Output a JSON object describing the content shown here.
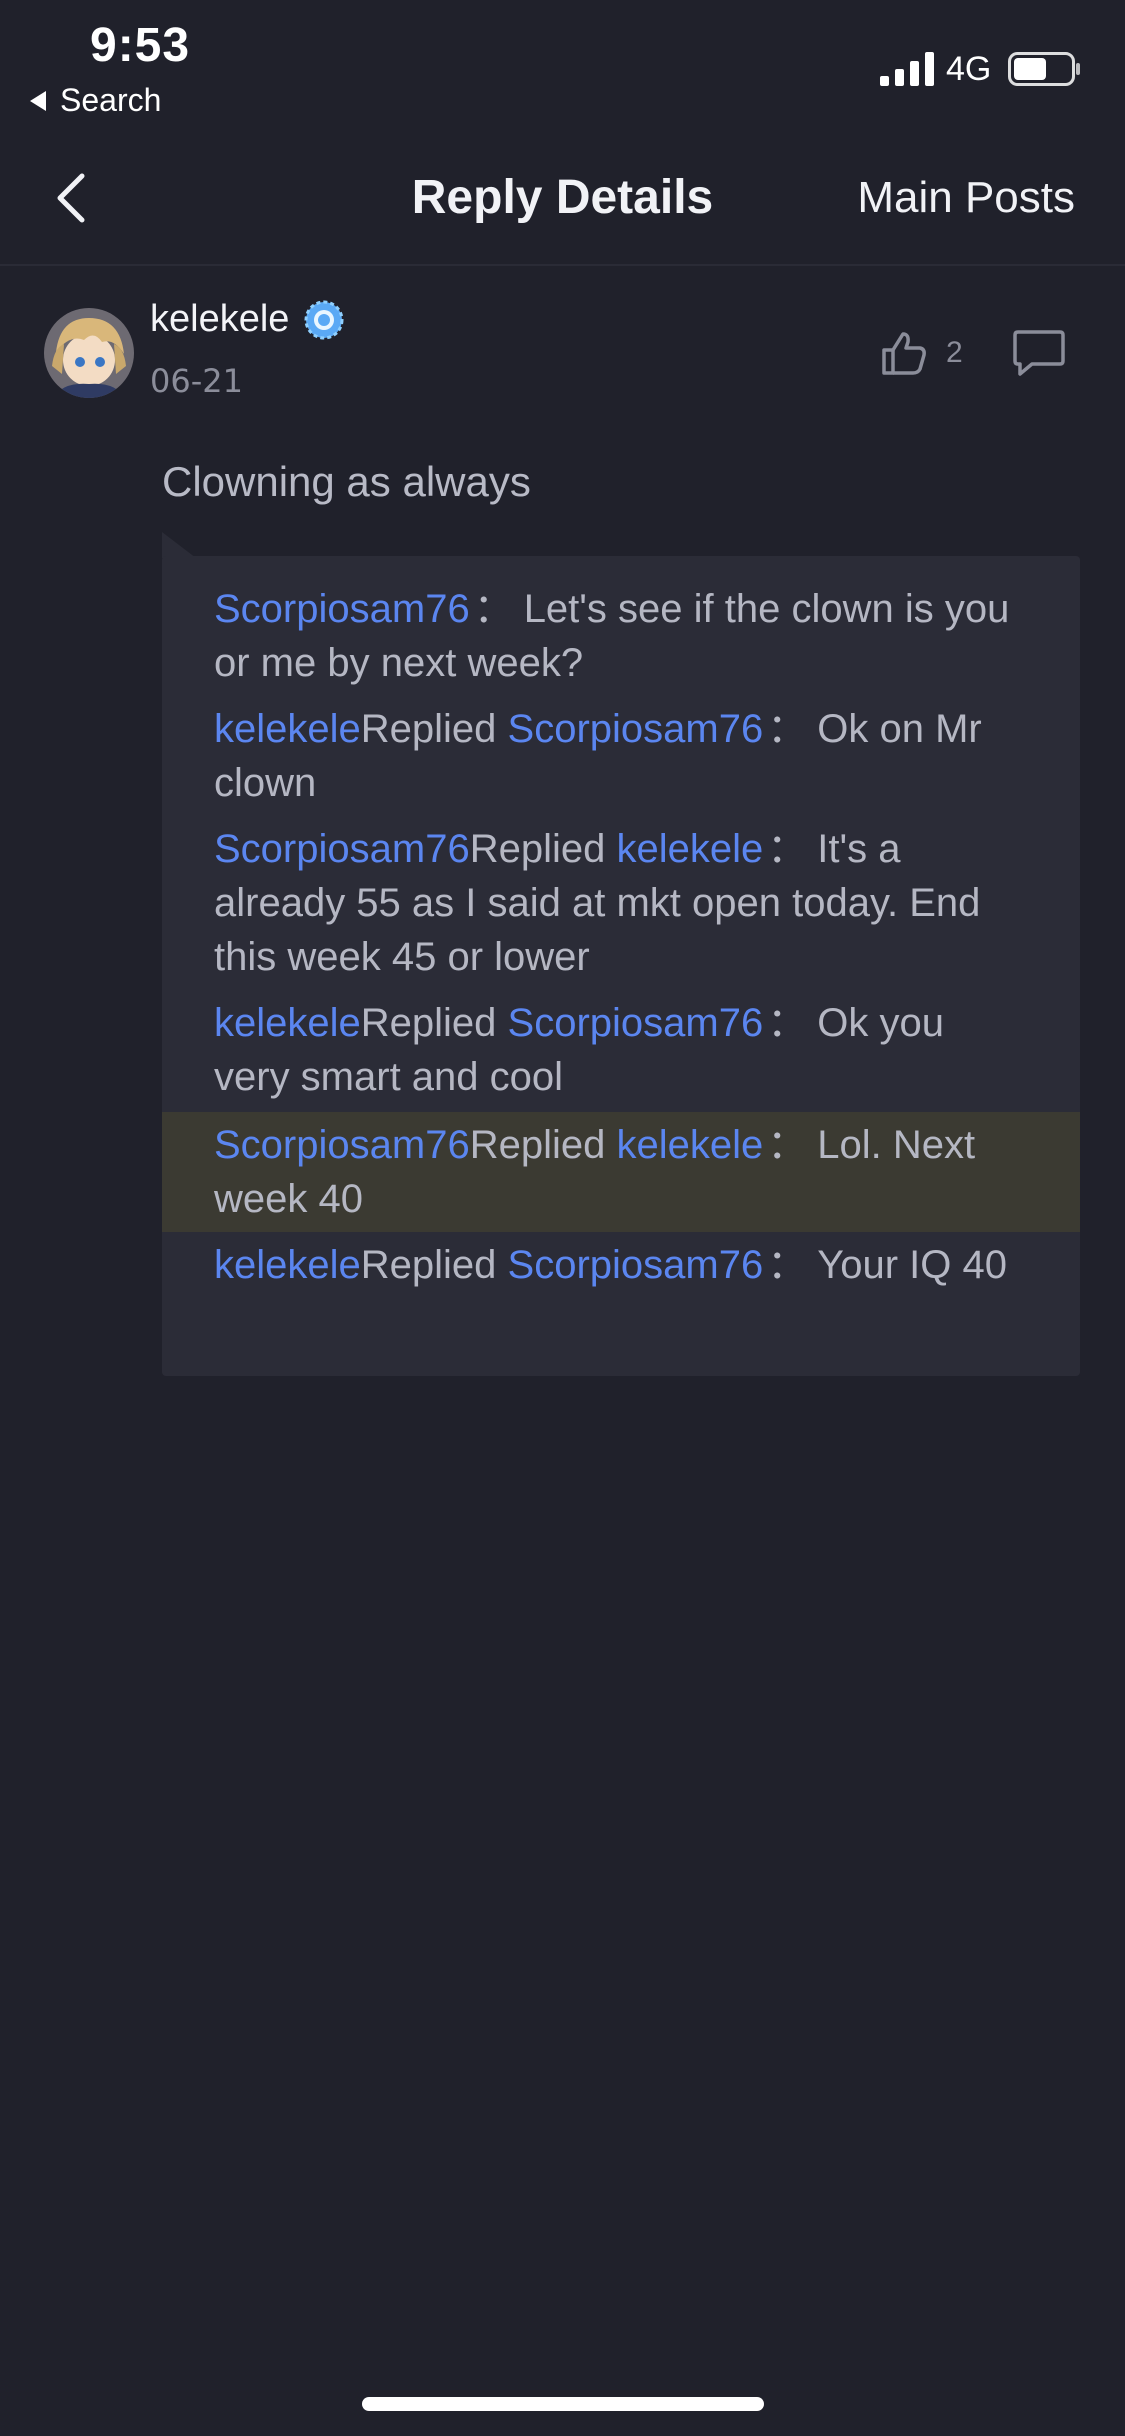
{
  "status_bar": {
    "time": "9:53",
    "back_label": "Search",
    "network": "4G"
  },
  "nav": {
    "title": "Reply Details",
    "right_label": "Main Posts"
  },
  "post": {
    "author": "kelekele",
    "date": "06-21",
    "like_count": "2",
    "content": "Clowning as always"
  },
  "thread": {
    "replied_word": "Replied",
    "colon": "：",
    "replies": [
      {
        "from": "Scorpiosam76",
        "to": "",
        "text": "Let's see if the clown is you or me by next week?"
      },
      {
        "from": "kelekele",
        "to": "Scorpiosam76",
        "text": "Ok on Mr clown"
      },
      {
        "from": "Scorpiosam76",
        "to": "kelekele",
        "text": "It's a already 55 as I said at mkt open today. End this week 45 or lower"
      },
      {
        "from": "kelekele",
        "to": "Scorpiosam76",
        "text": "Ok you very smart and cool"
      },
      {
        "from": "Scorpiosam76",
        "to": "kelekele",
        "text": "Lol. Next week 40",
        "highlighted": true
      },
      {
        "from": "kelekele",
        "to": "Scorpiosam76",
        "text": "Your IQ 40"
      }
    ]
  },
  "colors": {
    "background": "#20212b",
    "panel": "#2b2c37",
    "highlight": "#3b3a32",
    "username_link": "#5b86f0",
    "body_text": "#b5b7c3",
    "verified_badge": "#5aa9f5"
  },
  "icons": {
    "back": "chevron-left-icon",
    "verified": "verified-badge-icon",
    "like": "thumbs-up-icon",
    "comment": "comment-icon"
  }
}
